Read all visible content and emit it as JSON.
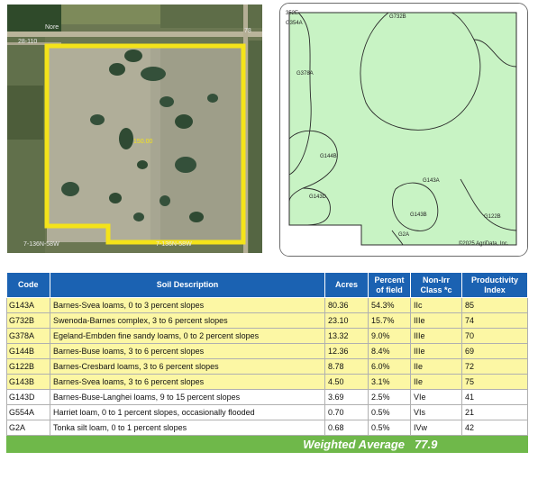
{
  "aerial": {
    "road_label_top": "Nore",
    "road_label_left": "28-110",
    "road_label_right": "78",
    "acre_label": "150.00",
    "section_label_left": "7-136N-58W",
    "section_label_bottom": "7-136N-58W",
    "boundary_color": "#f4e31a"
  },
  "soil_map": {
    "labels": {
      "g354a": "G354A",
      "g732b": "G732B",
      "g378a": "G378A",
      "g144b": "G144B",
      "g143d": "G143D",
      "g143a": "G143A",
      "g143b": "G143B",
      "g122b": "G122B",
      "g2a": "G2A"
    },
    "corner_code": "352E",
    "copyright": "©2025 AgriData, Inc.",
    "fill_color": "#c8f3c4"
  },
  "soil_table": {
    "headers": {
      "code": "Code",
      "description": "Soil Description",
      "acres": "Acres",
      "percent_line1": "Percent",
      "percent_line2": "of field",
      "class_line1": "Non-Irr",
      "class_line2": "Class *c",
      "pi_line1": "Productivity",
      "pi_line2": "Index"
    },
    "rows": [
      {
        "code": "G143A",
        "description": "Barnes-Svea loams, 0 to 3 percent slopes",
        "acres": "80.36",
        "percent": "54.3%",
        "class": "IIc",
        "pi": "85"
      },
      {
        "code": "G732B",
        "description": "Swenoda-Barnes complex, 3 to 6 percent slopes",
        "acres": "23.10",
        "percent": "15.7%",
        "class": "IIIe",
        "pi": "74"
      },
      {
        "code": "G378A",
        "description": "Egeland-Embden fine sandy loams, 0 to 2 percent slopes",
        "acres": "13.32",
        "percent": "9.0%",
        "class": "IIIe",
        "pi": "70"
      },
      {
        "code": "G144B",
        "description": "Barnes-Buse loams, 3 to 6 percent slopes",
        "acres": "12.36",
        "percent": "8.4%",
        "class": "IIIe",
        "pi": "69"
      },
      {
        "code": "G122B",
        "description": "Barnes-Cresbard loams, 3 to 6 percent slopes",
        "acres": "8.78",
        "percent": "6.0%",
        "class": "IIe",
        "pi": "72"
      },
      {
        "code": "G143B",
        "description": "Barnes-Svea loams, 3 to 6 percent slopes",
        "acres": "4.50",
        "percent": "3.1%",
        "class": "IIe",
        "pi": "75"
      },
      {
        "code": "G143D",
        "description": "Barnes-Buse-Langhei loams, 9 to 15 percent slopes",
        "acres": "3.69",
        "percent": "2.5%",
        "class": "VIe",
        "pi": "41"
      },
      {
        "code": "G554A",
        "description": "Harriet loam, 0 to 1 percent slopes, occasionally flooded",
        "acres": "0.70",
        "percent": "0.5%",
        "class": "VIs",
        "pi": "21"
      },
      {
        "code": "G2A",
        "description": "Tonka silt loam, 0 to 1 percent slopes",
        "acres": "0.68",
        "percent": "0.5%",
        "class": "IVw",
        "pi": "42"
      }
    ],
    "weighted_average_label": "Weighted Average",
    "weighted_average_value": "77.9",
    "highlight_color": "#fcf7a4",
    "header_color": "#1b62b2",
    "footer_color": "#6fb84a"
  }
}
